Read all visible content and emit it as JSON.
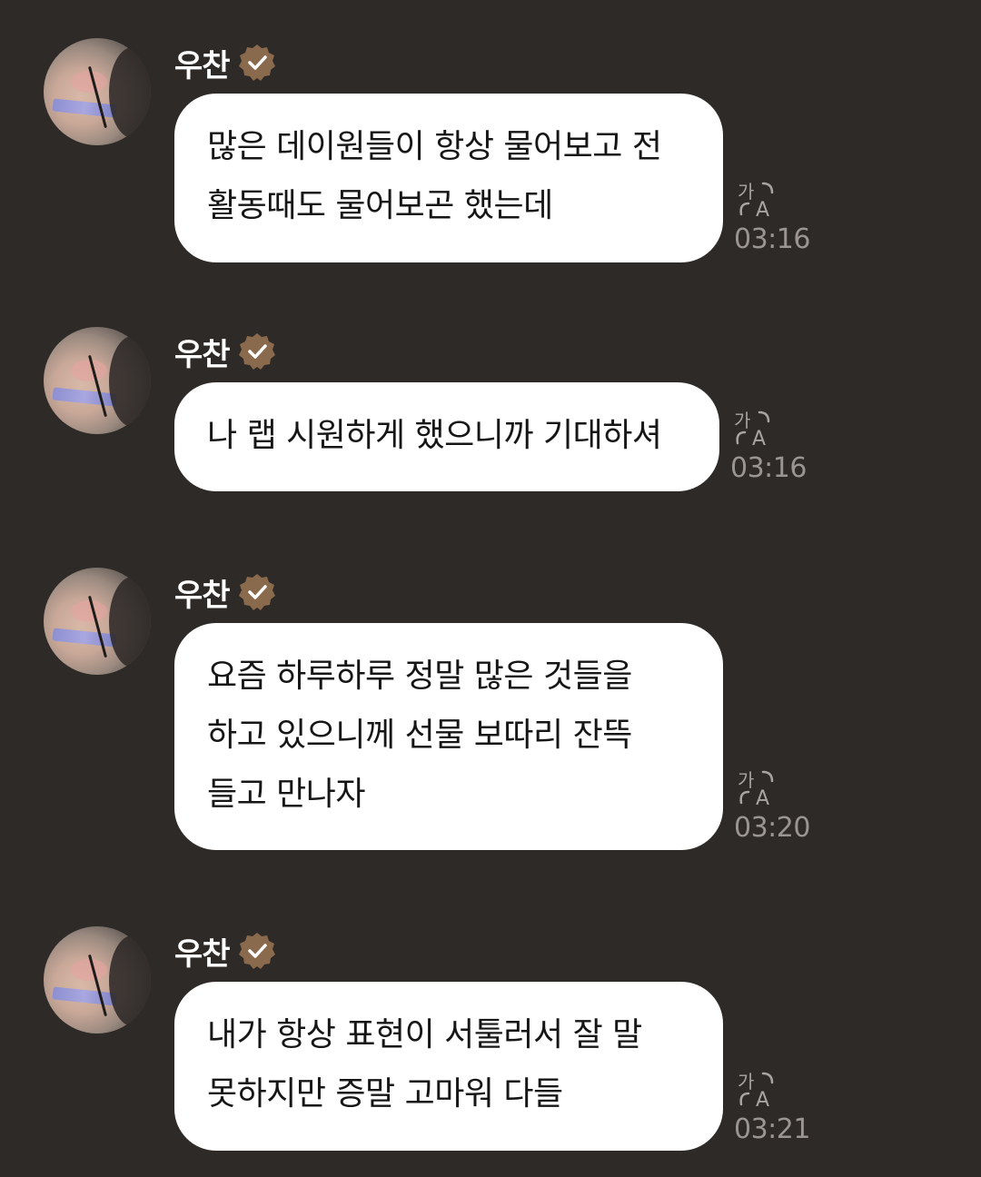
{
  "messages": [
    {
      "author": "우찬",
      "lines": [
        "많은 데이원들이 항상 물어보고 전",
        "활동때도 물어보곤 했는데"
      ],
      "time": "03:16"
    },
    {
      "author": "우찬",
      "lines": [
        "나 랩 시원하게 했으니까 기대하셔"
      ],
      "time": "03:16"
    },
    {
      "author": "우찬",
      "lines": [
        "요즘 하루하루 정말 많은 것들을",
        "하고 있으니께 선물 보따리 잔뜩",
        "들고 만나자"
      ],
      "time": "03:20"
    },
    {
      "author": "우찬",
      "lines": [
        "내가 항상 표현이 서툴러서 잘 말",
        "못하지만 증말 고마워 다들"
      ],
      "time": "03:21"
    }
  ],
  "icons": {
    "verified": "verified-badge-icon",
    "translate": "translate-icon"
  },
  "colors": {
    "background": "#2e2a27",
    "bubble": "#ffffff",
    "badge": "#8a6a4d",
    "timestamp": "#9a9592"
  }
}
